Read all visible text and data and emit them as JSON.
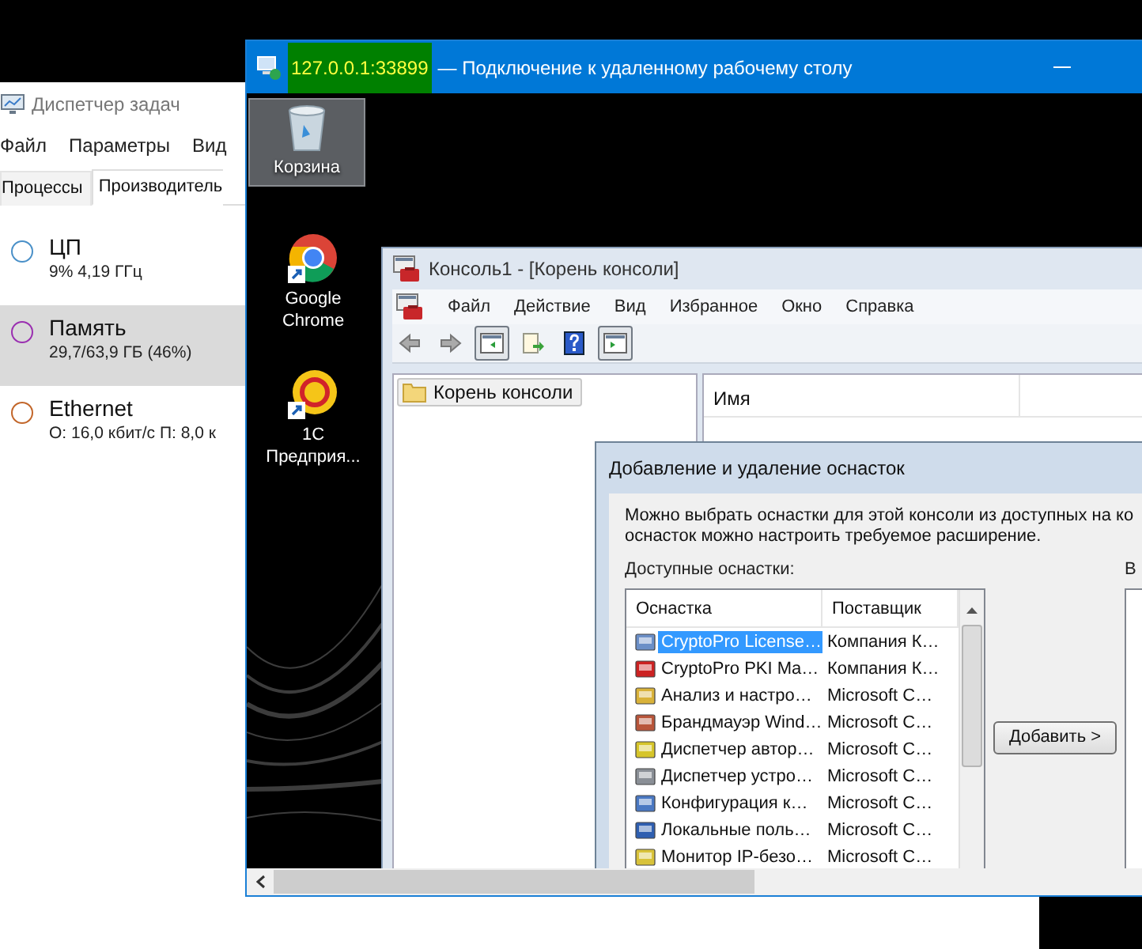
{
  "task_manager": {
    "title": "Диспетчер задач",
    "menu": [
      "Файл",
      "Параметры",
      "Вид"
    ],
    "tabs": [
      {
        "label": "Процессы",
        "selected": false
      },
      {
        "label": "Производитель",
        "selected": true
      }
    ],
    "resources": [
      {
        "name": "ЦП",
        "detail": "9% 4,19 ГГц",
        "color": "#4a90c8",
        "selected": false
      },
      {
        "name": "Память",
        "detail": "29,7/63,9 ГБ (46%)",
        "color": "#9a2fb0",
        "selected": true
      },
      {
        "name": "Ethernet",
        "detail": "О: 16,0 кбит/с П: 8,0 к",
        "color": "#c2662a",
        "selected": false
      }
    ]
  },
  "remote_desktop": {
    "title_host": "127.0.0.1:33899",
    "title_rest": "— Подключение к удаленному рабочему столу",
    "desktop_icons": [
      {
        "kind": "bin",
        "label": "Корзина",
        "selected": true
      },
      {
        "kind": "chrome",
        "label": "Google Chrome",
        "selected": false
      },
      {
        "kind": "onec",
        "label": "1С Предприя...",
        "selected": false
      }
    ]
  },
  "console": {
    "title": "Консоль1 - [Корень консоли]",
    "menu": [
      "Файл",
      "Действие",
      "Вид",
      "Избранное",
      "Окно",
      "Справка"
    ],
    "tree": [
      {
        "label": "Корень консоли",
        "selected": true
      }
    ],
    "columns": [
      "Имя"
    ]
  },
  "dialog": {
    "title": "Добавление и удаление оснасток",
    "description": [
      "Можно выбрать оснастки для этой консоли из доступных на ко",
      "оснасток можно настроить требуемое расширение."
    ],
    "available_label": "Доступные оснастки:",
    "selected_label": "В",
    "columns": [
      "Оснастка",
      "Поставщик"
    ],
    "snapins": [
      {
        "name": "CryptoPro License…",
        "vendor": "Компания К…",
        "selected": true
      },
      {
        "name": "CryptoPro PKI Ma…",
        "vendor": "Компания К…",
        "selected": false
      },
      {
        "name": "Анализ и настро…",
        "vendor": "Microsoft C…",
        "selected": false
      },
      {
        "name": "Брандмауэр Wind…",
        "vendor": "Microsoft C…",
        "selected": false
      },
      {
        "name": "Диспетчер автор…",
        "vendor": "Microsoft C…",
        "selected": false
      },
      {
        "name": "Диспетчер устро…",
        "vendor": "Microsoft C…",
        "selected": false
      },
      {
        "name": "Конфигурация к…",
        "vendor": "Microsoft C…",
        "selected": false
      },
      {
        "name": "Локальные поль…",
        "vendor": "Microsoft C…",
        "selected": false
      },
      {
        "name": "Монитор IP-безо…",
        "vendor": "Microsoft C…",
        "selected": false
      }
    ],
    "add_button": "Добавить >"
  }
}
